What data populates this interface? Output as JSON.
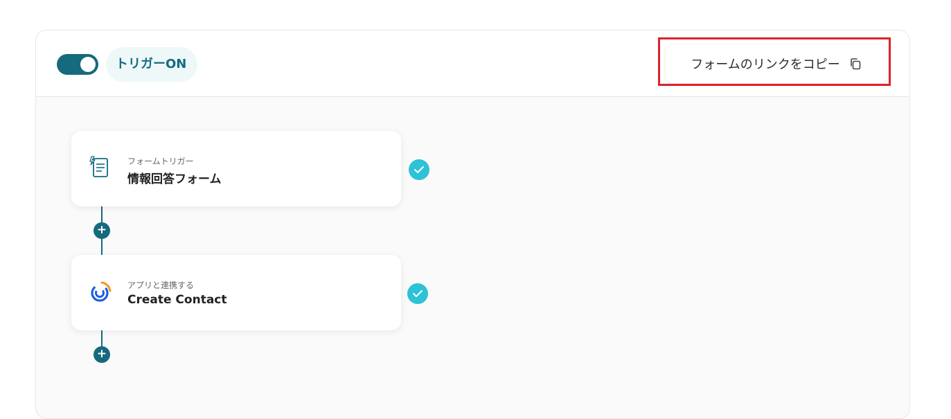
{
  "header": {
    "trigger_label": "トリガーON",
    "copy_link_label": "フォームのリンクをコピー",
    "toggle_on": true
  },
  "flow": {
    "steps": [
      {
        "subtitle": "フォームトリガー",
        "title": "情報回答フォーム",
        "icon": "form-icon",
        "status": "completed"
      },
      {
        "subtitle": "アプリと連携する",
        "title": "Create Contact",
        "icon": "constant-contact-logo",
        "status": "completed"
      }
    ],
    "add_step_glyph": "+"
  },
  "colors": {
    "accent": "#156a7d",
    "check": "#2dc2d6",
    "highlight": "#d8232a",
    "pill_bg": "#eef8f9"
  }
}
